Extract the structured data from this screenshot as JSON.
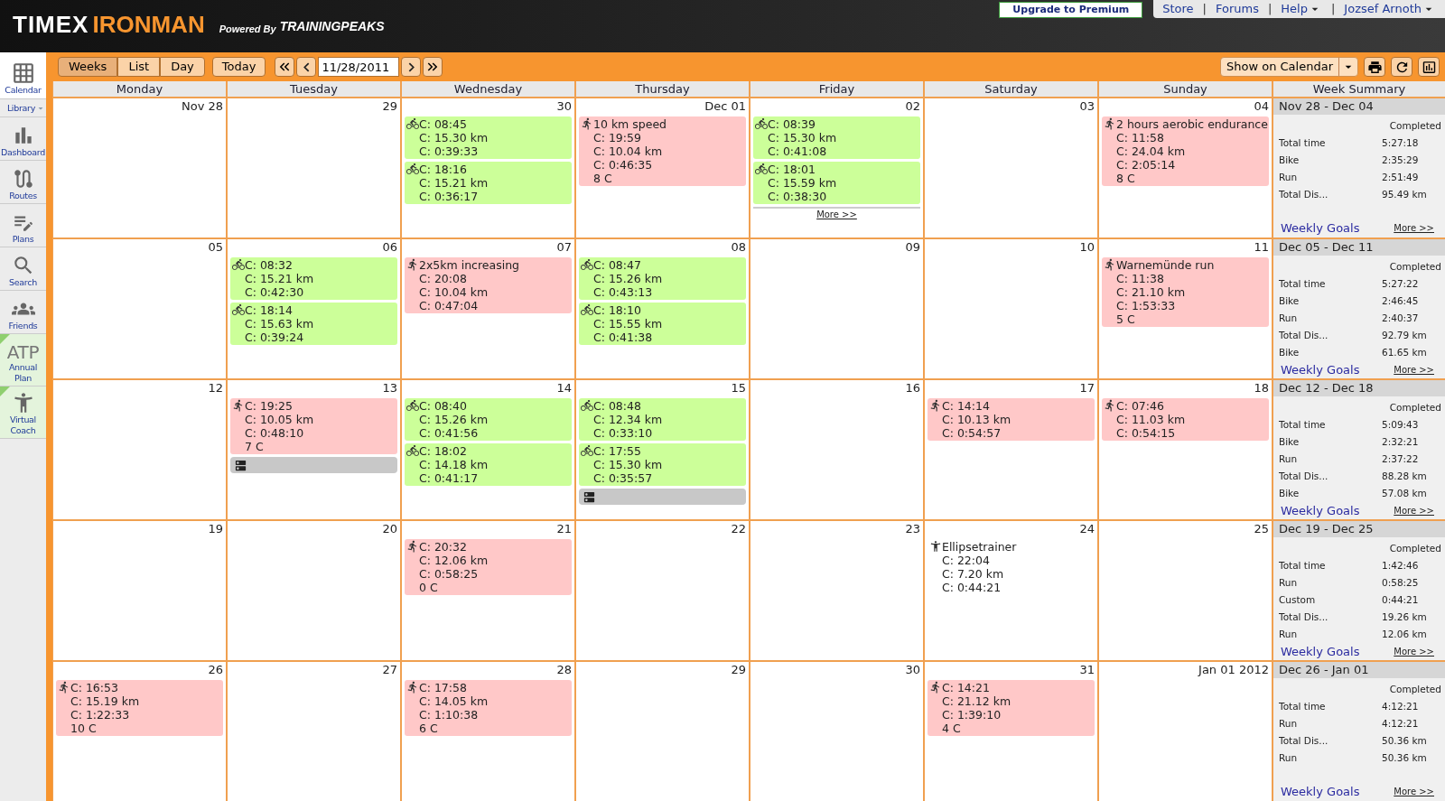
{
  "header": {
    "brand_1": "TIMEX",
    "brand_2": "IRONMAN",
    "powered_by": "Powered By",
    "partner": "TRAININGPEAKS",
    "upgrade": "Upgrade to Premium",
    "links": [
      {
        "label": "Store",
        "menu": false
      },
      {
        "label": "Forums",
        "menu": false
      },
      {
        "label": "Help",
        "menu": true
      },
      {
        "label": "Jozsef Arnoth",
        "menu": true
      }
    ],
    "separator": "|"
  },
  "sidebar": {
    "items": [
      {
        "label": "Calendar",
        "selected": true,
        "flagged": false
      },
      {
        "label": "Library",
        "selected": false,
        "flagged": false
      },
      {
        "label": "Dashboard",
        "selected": false,
        "flagged": false
      },
      {
        "label": "Routes",
        "selected": false,
        "flagged": false
      },
      {
        "label": "Plans",
        "selected": false,
        "flagged": false
      },
      {
        "label": "Search",
        "selected": false,
        "flagged": false
      },
      {
        "label": "Friends",
        "selected": false,
        "flagged": false
      },
      {
        "label": "Annual Plan",
        "icon_text": "ATP",
        "selected": false,
        "flagged": true
      },
      {
        "label": "Virtual Coach",
        "selected": false,
        "flagged": true
      }
    ]
  },
  "toolbar": {
    "views": [
      {
        "label": "Weeks",
        "selected": true
      },
      {
        "label": "List",
        "selected": false
      },
      {
        "label": "Day",
        "selected": false
      }
    ],
    "today": "Today",
    "date": "11/28/2011",
    "show_on_calendar": "Show on Calendar"
  },
  "calendar": {
    "days": [
      "Monday",
      "Tuesday",
      "Wednesday",
      "Thursday",
      "Friday",
      "Saturday",
      "Sunday"
    ],
    "summary_title": "Week Summary",
    "weeks": [
      {
        "cells": [
          {
            "date": "Nov 28"
          },
          {
            "date": "29"
          },
          {
            "date": "30",
            "workouts": [
              {
                "kind": "bike",
                "lines": [
                  "C: 08:45",
                  "C: 15.30 km",
                  "C: 0:39:33"
                ]
              },
              {
                "kind": "bike",
                "lines": [
                  "C: 18:16",
                  "C: 15.21 km",
                  "C: 0:36:17"
                ]
              }
            ]
          },
          {
            "date": "Dec 01",
            "workouts": [
              {
                "kind": "run",
                "lines": [
                  "10 km speed",
                  "C: 19:59",
                  "C: 10.04 km",
                  "C: 0:46:35",
                  "8 C"
                ]
              }
            ]
          },
          {
            "date": "02",
            "workouts": [
              {
                "kind": "bike",
                "lines": [
                  "C: 08:39",
                  "C: 15.30 km",
                  "C: 0:41:08"
                ]
              },
              {
                "kind": "bike",
                "lines": [
                  "C: 18:01",
                  "C: 15.59 km",
                  "C: 0:38:30"
                ]
              }
            ],
            "more": "More >>"
          },
          {
            "date": "03"
          },
          {
            "date": "04",
            "workouts": [
              {
                "kind": "run",
                "lines": [
                  "2 hours aerobic endurance",
                  "C: 11:58",
                  "C: 24.04 km",
                  "C: 2:05:14",
                  "8 C"
                ]
              }
            ]
          }
        ],
        "summary": {
          "range": "Nov 28 - Dec 04",
          "heading": "Completed",
          "rows": [
            {
              "label": "Total time",
              "value": "5:27:18"
            },
            {
              "label": "Bike",
              "value": "2:35:29"
            },
            {
              "label": "Run",
              "value": "2:51:49"
            },
            {
              "label": "Total Dis...",
              "value": "95.49 km"
            }
          ],
          "goals": "Weekly Goals",
          "more": "More >>"
        }
      },
      {
        "cells": [
          {
            "date": "05"
          },
          {
            "date": "06",
            "workouts": [
              {
                "kind": "bike",
                "lines": [
                  "C: 08:32",
                  "C: 15.21 km",
                  "C: 0:42:30"
                ]
              },
              {
                "kind": "bike",
                "lines": [
                  "C: 18:14",
                  "C: 15.63 km",
                  "C: 0:39:24"
                ]
              }
            ]
          },
          {
            "date": "07",
            "workouts": [
              {
                "kind": "run",
                "lines": [
                  "2x5km increasing",
                  "C: 20:08",
                  "C: 10.04 km",
                  "C: 0:47:04"
                ]
              }
            ]
          },
          {
            "date": "08",
            "workouts": [
              {
                "kind": "bike",
                "lines": [
                  "C: 08:47",
                  "C: 15.26 km",
                  "C: 0:43:13"
                ]
              },
              {
                "kind": "bike",
                "lines": [
                  "C: 18:10",
                  "C: 15.55 km",
                  "C: 0:41:38"
                ]
              }
            ]
          },
          {
            "date": "09"
          },
          {
            "date": "10"
          },
          {
            "date": "11",
            "workouts": [
              {
                "kind": "run",
                "lines": [
                  "Warnemünde run",
                  "C: 11:38",
                  "C: 21.10 km",
                  "C: 1:53:33",
                  "5 C"
                ]
              }
            ]
          }
        ],
        "summary": {
          "range": "Dec 05 - Dec 11",
          "heading": "Completed",
          "rows": [
            {
              "label": "Total time",
              "value": "5:27:22"
            },
            {
              "label": "Bike",
              "value": "2:46:45"
            },
            {
              "label": "Run",
              "value": "2:40:37"
            },
            {
              "label": "Total Dis...",
              "value": "92.79 km"
            },
            {
              "label": "Bike",
              "value": "61.65 km"
            }
          ],
          "goals": "Weekly Goals",
          "more": "More >>"
        }
      },
      {
        "cells": [
          {
            "date": "12"
          },
          {
            "date": "13",
            "workouts": [
              {
                "kind": "run",
                "lines": [
                  "C: 19:25",
                  "C: 10.05 km",
                  "C: 0:48:10",
                  "7 C"
                ]
              },
              {
                "kind": "note"
              }
            ]
          },
          {
            "date": "14",
            "workouts": [
              {
                "kind": "bike",
                "lines": [
                  "C: 08:40",
                  "C: 15.26 km",
                  "C: 0:41:56"
                ]
              },
              {
                "kind": "bike",
                "lines": [
                  "C: 18:02",
                  "C: 14.18 km",
                  "C: 0:41:17"
                ]
              }
            ]
          },
          {
            "date": "15",
            "workouts": [
              {
                "kind": "bike",
                "lines": [
                  "C: 08:48",
                  "C: 12.34 km",
                  "C: 0:33:10"
                ]
              },
              {
                "kind": "bike",
                "lines": [
                  "C: 17:55",
                  "C: 15.30 km",
                  "C: 0:35:57"
                ]
              },
              {
                "kind": "note"
              }
            ]
          },
          {
            "date": "16"
          },
          {
            "date": "17",
            "workouts": [
              {
                "kind": "run",
                "lines": [
                  "C: 14:14",
                  "C: 10.13 km",
                  "C: 0:54:57"
                ]
              }
            ]
          },
          {
            "date": "18",
            "workouts": [
              {
                "kind": "run",
                "lines": [
                  "C: 07:46",
                  "C: 11.03 km",
                  "C: 0:54:15"
                ]
              }
            ]
          }
        ],
        "summary": {
          "range": "Dec 12 - Dec 18",
          "heading": "Completed",
          "rows": [
            {
              "label": "Total time",
              "value": "5:09:43"
            },
            {
              "label": "Bike",
              "value": "2:32:21"
            },
            {
              "label": "Run",
              "value": "2:37:22"
            },
            {
              "label": "Total Dis...",
              "value": "88.28 km"
            },
            {
              "label": "Bike",
              "value": "57.08 km"
            }
          ],
          "goals": "Weekly Goals",
          "more": "More >>"
        }
      },
      {
        "cells": [
          {
            "date": "19"
          },
          {
            "date": "20"
          },
          {
            "date": "21",
            "workouts": [
              {
                "kind": "run",
                "lines": [
                  "C: 20:32",
                  "C: 12.06 km",
                  "C: 0:58:25",
                  "0 C"
                ]
              }
            ]
          },
          {
            "date": "22"
          },
          {
            "date": "23"
          },
          {
            "date": "24",
            "workouts": [
              {
                "kind": "custom",
                "lines": [
                  "Ellipsetrainer",
                  "C: 22:04",
                  "C: 7.20 km",
                  "C: 0:44:21"
                ]
              }
            ]
          },
          {
            "date": "25"
          }
        ],
        "summary": {
          "range": "Dec 19 - Dec 25",
          "heading": "Completed",
          "rows": [
            {
              "label": "Total time",
              "value": "1:42:46"
            },
            {
              "label": "Run",
              "value": "0:58:25"
            },
            {
              "label": "Custom",
              "value": "0:44:21"
            },
            {
              "label": "Total Dis...",
              "value": "19.26 km"
            },
            {
              "label": "Run",
              "value": "12.06 km"
            }
          ],
          "goals": "Weekly Goals",
          "more": "More >>"
        }
      },
      {
        "cells": [
          {
            "date": "26",
            "workouts": [
              {
                "kind": "run",
                "lines": [
                  "C: 16:53",
                  "C: 15.19 km",
                  "C: 1:22:33",
                  "10 C"
                ]
              }
            ]
          },
          {
            "date": "27"
          },
          {
            "date": "28",
            "workouts": [
              {
                "kind": "run",
                "lines": [
                  "C: 17:58",
                  "C: 14.05 km",
                  "C: 1:10:38",
                  "6 C"
                ]
              }
            ]
          },
          {
            "date": "29"
          },
          {
            "date": "30"
          },
          {
            "date": "31",
            "workouts": [
              {
                "kind": "run",
                "lines": [
                  "C: 14:21",
                  "C: 21.12 km",
                  "C: 1:39:10",
                  "4 C"
                ]
              }
            ]
          },
          {
            "date": "Jan 01 2012"
          }
        ],
        "summary": {
          "range": "Dec 26 - Jan 01",
          "heading": "Completed",
          "rows": [
            {
              "label": "Total time",
              "value": "4:12:21"
            },
            {
              "label": "Run",
              "value": "4:12:21"
            },
            {
              "label": "Total Dis...",
              "value": "50.36 km"
            },
            {
              "label": "Run",
              "value": "50.36 km"
            }
          ],
          "goals": "Weekly Goals",
          "more": "More >>"
        }
      }
    ]
  }
}
